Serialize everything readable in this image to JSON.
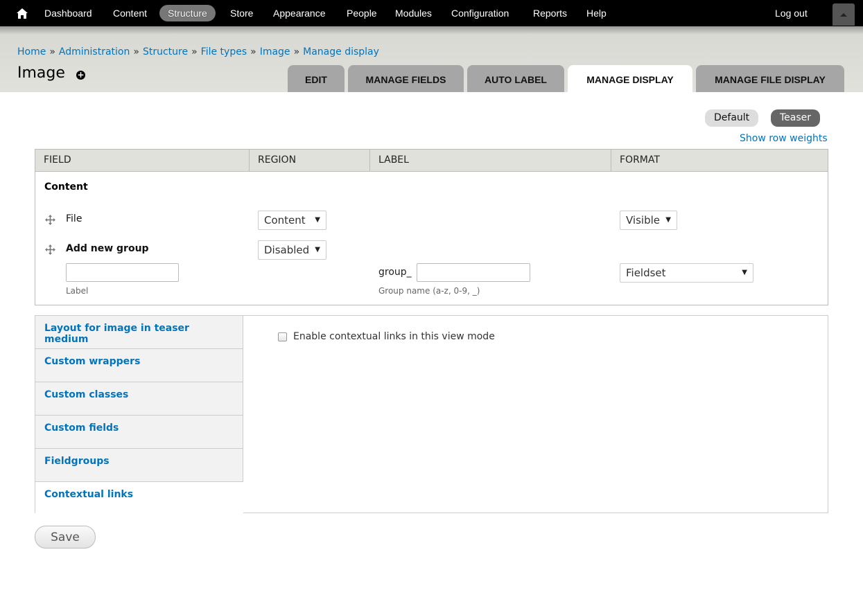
{
  "toolbar": {
    "home_icon": "home-icon",
    "items": [
      "Dashboard",
      "Content",
      "Structure",
      "Store",
      "Appearance",
      "People",
      "Modules",
      "Configuration",
      "Reports",
      "Help"
    ],
    "active_item": "Structure",
    "logout": "Log out",
    "toggle_icon": "triangle-up-icon"
  },
  "breadcrumb": [
    "Home",
    "Administration",
    "Structure",
    "File types",
    "Image",
    "Manage display"
  ],
  "breadcrumb_separator": "»",
  "page": {
    "title": "Image",
    "add_icon": "plus-circle-icon"
  },
  "tabs": [
    "EDIT",
    "MANAGE FIELDS",
    "AUTO LABEL",
    "MANAGE DISPLAY",
    "MANAGE FILE DISPLAY"
  ],
  "active_tab": "MANAGE DISPLAY",
  "view_modes": {
    "default": "Default",
    "teaser": "Teaser"
  },
  "show_row_weights": "Show row weights",
  "table": {
    "headers": [
      "FIELD",
      "REGION",
      "LABEL",
      "FORMAT"
    ],
    "region_title": "Content",
    "rows": {
      "file": {
        "label": "File",
        "region": "Content",
        "format": "Visible"
      },
      "new_group": {
        "label": "Add new group",
        "region": "Disabled",
        "label_input_value": "",
        "label_desc": "Label",
        "name_prefix": "group_",
        "name_input_value": "",
        "name_desc": "Group name (a-z, 0-9, _)",
        "format": "Fieldset"
      }
    }
  },
  "vertical_tabs": [
    "Layout for image in teaser medium",
    "Custom wrappers",
    "Custom classes",
    "Custom fields",
    "Fieldgroups",
    "Contextual links"
  ],
  "selected_vertical_tab": "Contextual links",
  "contextual": {
    "checkbox_label": "Enable contextual links in this view mode",
    "checked": false
  },
  "save_label": "Save",
  "colors": {
    "link": "#0074bd",
    "toolbar_bg": "#000000",
    "active_pill": "#777777",
    "tab_bg": "#a6a6a6"
  }
}
